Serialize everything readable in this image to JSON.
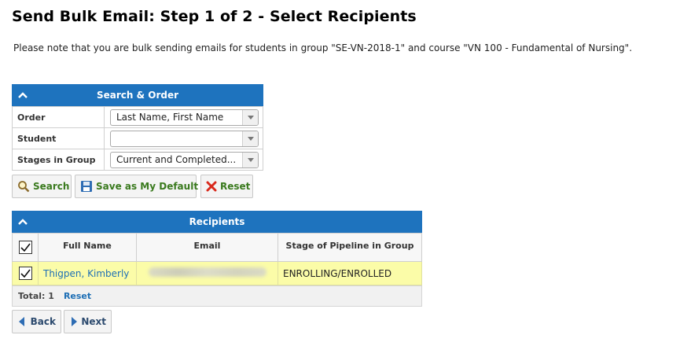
{
  "page": {
    "title": "Send Bulk Email: Step 1 of 2 - Select Recipients",
    "note": "Please note that you are bulk sending emails for students in group \"SE-VN-2018-1\" and course \"VN 100 - Fundamental of Nursing\"."
  },
  "search_panel": {
    "title": "Search & Order",
    "fields": [
      {
        "label": "Order",
        "value": "Last Name, First Name"
      },
      {
        "label": "Student",
        "value": ""
      },
      {
        "label": "Stages in Group",
        "value": "Current and Completed..."
      }
    ],
    "buttons": {
      "search": "Search",
      "save_default": "Save as My Default",
      "reset": "Reset"
    }
  },
  "recipients_panel": {
    "title": "Recipients",
    "columns": [
      "Full Name",
      "Email",
      "Stage of Pipeline in Group"
    ],
    "rows": [
      {
        "name": "Thigpen, Kimberly",
        "email_blurred": true,
        "stage": "ENROLLING/ENROLLED",
        "selected": true
      }
    ],
    "total_label": "Total: 1",
    "reset_label": "Reset"
  },
  "nav": {
    "back": "Back",
    "next": "Next"
  },
  "colors": {
    "header_blue": "#1e73be",
    "row_highlight": "#fbfca8",
    "link": "#1e6fb5",
    "button_text_green": "#3a7a1e"
  }
}
